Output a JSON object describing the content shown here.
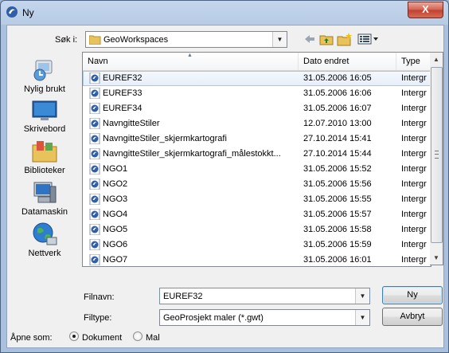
{
  "window": {
    "title": "Ny",
    "close_label": "X"
  },
  "look_in": {
    "label": "Søk i:",
    "value": "GeoWorkspaces"
  },
  "toolbar": {
    "icons": [
      "back-arrow-icon",
      "up-folder-icon",
      "new-folder-icon",
      "view-menu-icon"
    ]
  },
  "places": [
    {
      "label": "Nylig brukt",
      "icon": "recent-places-icon"
    },
    {
      "label": "Skrivebord",
      "icon": "desktop-icon"
    },
    {
      "label": "Biblioteker",
      "icon": "libraries-icon"
    },
    {
      "label": "Datamaskin",
      "icon": "computer-icon"
    },
    {
      "label": "Nettverk",
      "icon": "network-icon"
    }
  ],
  "columns": {
    "name": "Navn",
    "date": "Dato endret",
    "type": "Type"
  },
  "files": [
    {
      "name": "EUREF32",
      "date": "31.05.2006 16:05",
      "type": "Intergr",
      "selected": true
    },
    {
      "name": "EUREF33",
      "date": "31.05.2006 16:06",
      "type": "Intergr"
    },
    {
      "name": "EUREF34",
      "date": "31.05.2006 16:07",
      "type": "Intergr"
    },
    {
      "name": "NavngitteStiler",
      "date": "12.07.2010 13:00",
      "type": "Intergr"
    },
    {
      "name": "NavngitteStiler_skjermkartografi",
      "date": "27.10.2014 15:41",
      "type": "Intergr"
    },
    {
      "name": "NavngitteStiler_skjermkartografi_målestokkt...",
      "date": "27.10.2014 15:44",
      "type": "Intergr"
    },
    {
      "name": "NGO1",
      "date": "31.05.2006 15:52",
      "type": "Intergr"
    },
    {
      "name": "NGO2",
      "date": "31.05.2006 15:56",
      "type": "Intergr"
    },
    {
      "name": "NGO3",
      "date": "31.05.2006 15:55",
      "type": "Intergr"
    },
    {
      "name": "NGO4",
      "date": "31.05.2006 15:57",
      "type": "Intergr"
    },
    {
      "name": "NGO5",
      "date": "31.05.2006 15:58",
      "type": "Intergr"
    },
    {
      "name": "NGO6",
      "date": "31.05.2006 15:59",
      "type": "Intergr"
    },
    {
      "name": "NGO7",
      "date": "31.05.2006 16:01",
      "type": "Intergr"
    }
  ],
  "filename": {
    "label": "Filnavn:",
    "value": "EUREF32"
  },
  "filetype": {
    "label": "Filtype:",
    "value": "GeoProsjekt maler (*.gwt)"
  },
  "buttons": {
    "ok": "Ny",
    "cancel": "Avbryt"
  },
  "open_as": {
    "label": "Åpne som:",
    "options": [
      "Dokument",
      "Mal"
    ],
    "selected": "Dokument"
  },
  "colors": {
    "title_gradient": "#b7cbe4",
    "client_bg": "#f0f0f0",
    "selection_border": "#a9c6ea",
    "close_red": "#c1402e"
  }
}
